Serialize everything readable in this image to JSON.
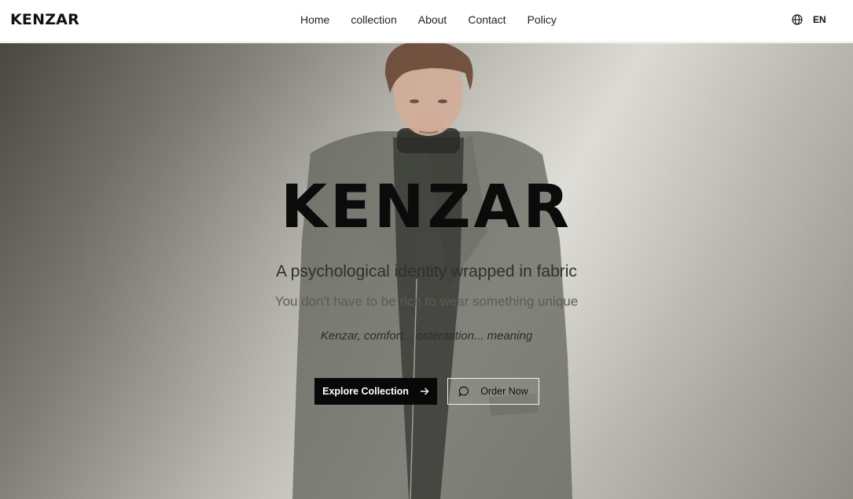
{
  "header": {
    "logo": "KENZAR",
    "nav": [
      "Home",
      "collection",
      "About",
      "Contact",
      "Policy"
    ],
    "language": "EN",
    "language_icon": "globe-icon"
  },
  "hero": {
    "title": "KENZAR",
    "subtitle": "A psychological identity wrapped in fabric",
    "secondary": "You don't have to be rich to wear something unique",
    "tagline": "Kenzar, comfort... ostentation... meaning",
    "primary_button": {
      "label": "Explore Collection",
      "icon": "arrow-right-icon"
    },
    "secondary_button": {
      "label": "Order Now",
      "icon": "chat-bubble-icon"
    },
    "image": "model-in-grey-coat"
  },
  "colors": {
    "primary_button_bg": "#080808",
    "text_dark": "#0b0b0b",
    "header_bg": "#ffffff"
  }
}
